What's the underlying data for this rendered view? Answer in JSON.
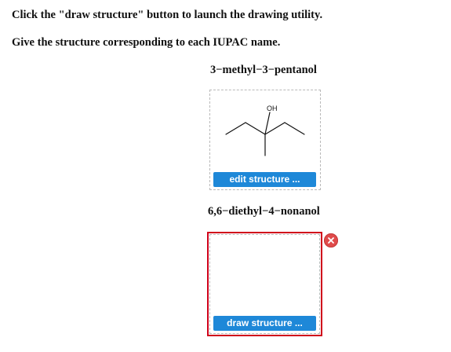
{
  "instructions": {
    "line1": "Click the \"draw structure\" button to launch the drawing utility.",
    "line2": "Give the structure corresponding to each IUPAC name."
  },
  "questions": [
    {
      "name": "3−methyl−3−pentanol",
      "structure_label": "OH",
      "button_label": "edit structure ..."
    },
    {
      "name": "6,6−diethyl−4−nonanol",
      "button_label": "draw structure ..."
    }
  ],
  "colors": {
    "button": "#1e88d8",
    "error_border": "#d0021b",
    "close_button": "#e04b4b"
  },
  "icons": {
    "remove": "close-icon"
  }
}
